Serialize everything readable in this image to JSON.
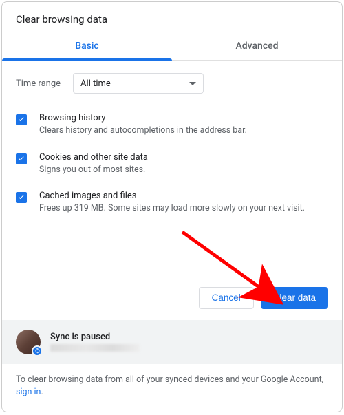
{
  "dialog": {
    "title": "Clear browsing data"
  },
  "tabs": {
    "basic": "Basic",
    "advanced": "Advanced"
  },
  "timeRange": {
    "label": "Time range",
    "value": "All time"
  },
  "options": {
    "history": {
      "title": "Browsing history",
      "desc": "Clears history and autocompletions in the address bar."
    },
    "cookies": {
      "title": "Cookies and other site data",
      "desc": "Signs you out of most sites."
    },
    "cache": {
      "title": "Cached images and files",
      "desc": "Frees up 319 MB. Some sites may load more slowly on your next visit."
    }
  },
  "buttons": {
    "cancel": "Cancel",
    "clear": "Clear data"
  },
  "sync": {
    "title": "Sync is paused"
  },
  "footer": {
    "textBefore": "To clear browsing data from all of your synced devices and your Google Account, ",
    "link": "sign in",
    "textAfter": "."
  },
  "colors": {
    "accent": "#1a73e8"
  }
}
